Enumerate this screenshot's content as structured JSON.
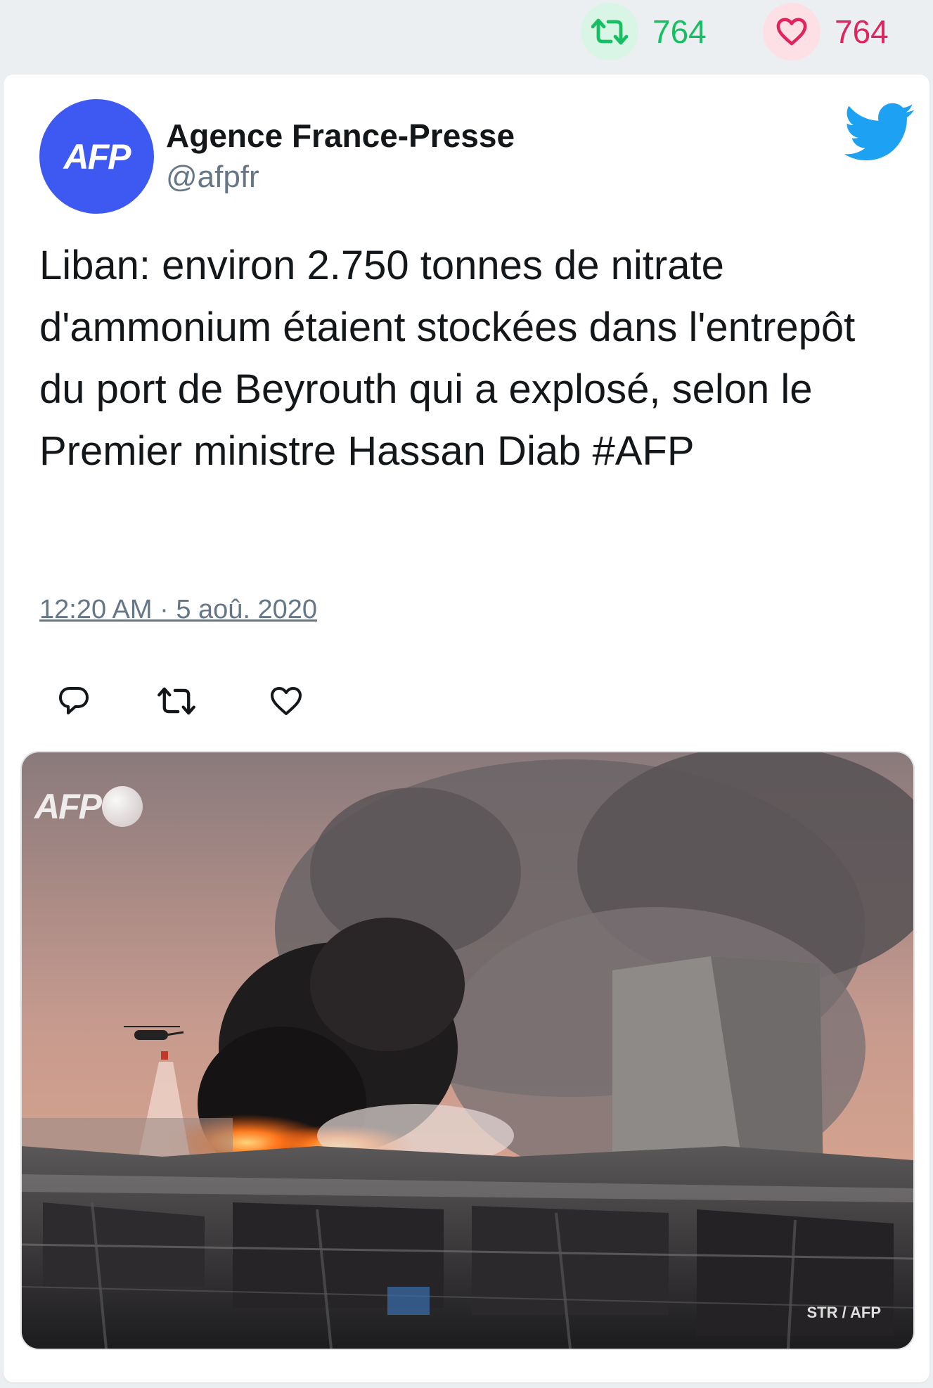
{
  "stats": {
    "retweet_count": "764",
    "like_count": "764",
    "retweet_icon": "retweet-icon",
    "like_icon": "heart-icon",
    "retweet_color": "#17bf63",
    "like_color": "#e0245e"
  },
  "tweet": {
    "author_name": "Agence France-Presse",
    "author_handle": "@afpfr",
    "avatar_text": "AFP",
    "avatar_color": "#3d59f2",
    "text": "Liban: environ 2.750 tonnes de nitrate d'ammonium étaient stockées dans l'entrepôt du port de Beyrouth qui a explosé, selon le Premier ministre Hassan Diab #AFP",
    "timestamp": "12:20 AM · 5 aoû. 2020",
    "brand_icon": "twitter-bird-icon",
    "brand_color": "#1da1f2"
  },
  "actions": [
    {
      "name": "reply",
      "icon": "reply-icon"
    },
    {
      "name": "retweet",
      "icon": "retweet-icon"
    },
    {
      "name": "like",
      "icon": "heart-icon"
    }
  ],
  "media": {
    "watermark": "AFP",
    "credit": "STR / AFP"
  }
}
